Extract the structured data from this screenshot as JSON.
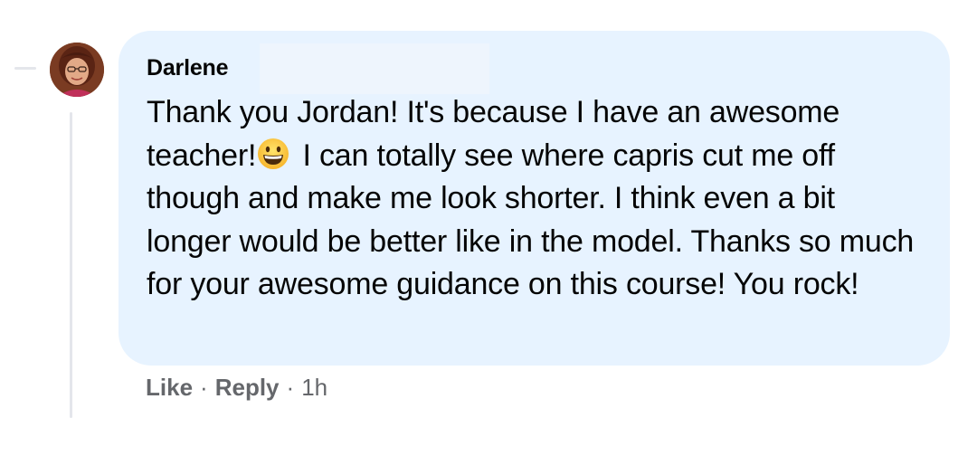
{
  "comment": {
    "author": "Darlene",
    "text_part1": "Thank you Jordan! It's because I have an awesome teacher!",
    "emoji": "grinning-face-emoji",
    "text_part2": " I can totally see where capris cut me off though and make me look shorter. I think even a bit longer would be better like in the model. Thanks so much for your awesome guidance on this course! You rock!",
    "actions": {
      "like_label": "Like",
      "separator": "·",
      "reply_label": "Reply",
      "timestamp": "1h"
    }
  },
  "colors": {
    "bubble_background": "#e7f3ff",
    "text": "#050505",
    "secondary_text": "#65676b",
    "thread_line": "#e4e6eb"
  }
}
